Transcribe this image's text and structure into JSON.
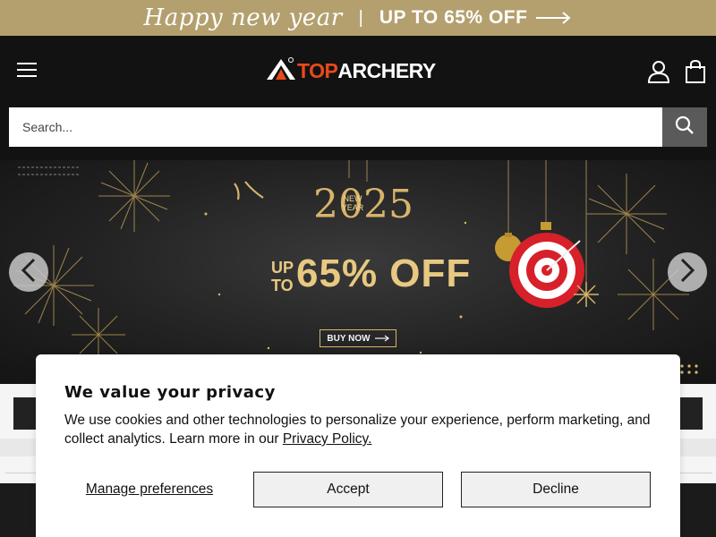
{
  "promo": {
    "script_text": "Happy new year",
    "separator": "|",
    "offer_text": "UP TO 65% OFF",
    "arrow_icon": "long-arrow-right-icon",
    "background": "#b3a06e"
  },
  "header": {
    "menu_icon": "hamburger-menu-icon",
    "logo_part_a": "TOP",
    "logo_part_b": "ARCHERY",
    "logo_mark_icon": "archery-tent-logo-icon",
    "account_icon": "user-account-icon",
    "cart_icon": "shopping-bag-icon",
    "brand_color": "#e84a1a",
    "background": "#121212"
  },
  "search": {
    "placeholder": "Search...",
    "button_icon": "search-icon"
  },
  "banner": {
    "year_big": "2025",
    "year_small": "NEW YEAR",
    "upto": "UP TO",
    "off": "65% OFF",
    "buy_now": "BUY NOW",
    "prev_icon": "chevron-left-icon",
    "next_icon": "chevron-right-icon",
    "gold": "#e8c981"
  },
  "cookie": {
    "title": "We value your privacy",
    "text": "We use cookies and other technologies to personalize your experience, perform marketing, and collect analytics. Learn more in our",
    "link": "Privacy Policy.",
    "manage": "Manage preferences",
    "accept": "Accept",
    "decline": "Decline"
  }
}
